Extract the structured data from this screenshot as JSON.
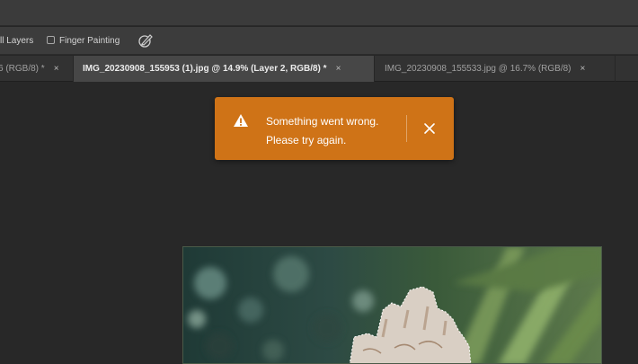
{
  "options_bar": {
    "sample_all_layers_label": "ll Layers",
    "finger_painting_label": "Finger Painting",
    "brush_icon": "brush-settings-icon"
  },
  "tabs": [
    {
      "label": "6 (RGB/8) *",
      "close": "×",
      "active": false
    },
    {
      "label": "IMG_20230908_155953 (1).jpg @ 14.9% (Layer 2, RGB/8) *",
      "close": "×",
      "active": true
    },
    {
      "label": "IMG_20230908_155533.jpg @ 16.7% (RGB/8)",
      "close": "×",
      "active": false
    }
  ],
  "toast": {
    "line1": "Something went wrong.",
    "line2": "Please try again.",
    "icon": "warning-icon",
    "close_icon": "close-icon",
    "color": "#cf7317"
  },
  "canvas": {
    "image_description_icon": "photo-canvas"
  }
}
